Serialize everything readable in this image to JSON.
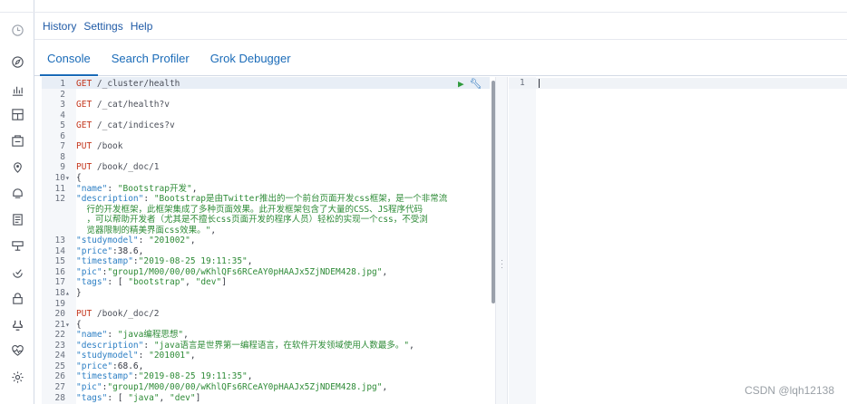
{
  "menu": [
    "History",
    "Settings",
    "Help"
  ],
  "tabs": [
    "Console",
    "Search Profiler",
    "Grok Debugger"
  ],
  "sidebar_icons": [
    "clock-icon",
    "compass-icon",
    "chart-icon",
    "dashboard-icon",
    "canvas-icon",
    "maps-icon",
    "ml-icon",
    "logs-icon",
    "metrics-icon",
    "apm-icon",
    "security-icon",
    "devtools-icon",
    "monitoring-icon",
    "settings-icon"
  ],
  "editor": {
    "lines": [
      {
        "n": "1",
        "f": "",
        "parts": [
          [
            "method",
            "GET"
          ],
          [
            "path",
            " /_cluster/health"
          ]
        ]
      },
      {
        "n": "2",
        "f": "",
        "parts": []
      },
      {
        "n": "3",
        "f": "",
        "parts": [
          [
            "method",
            "GET"
          ],
          [
            "path",
            " /_cat/health?v"
          ]
        ]
      },
      {
        "n": "4",
        "f": "",
        "parts": []
      },
      {
        "n": "5",
        "f": "",
        "parts": [
          [
            "method",
            "GET"
          ],
          [
            "path",
            " /_cat/indices?v"
          ]
        ]
      },
      {
        "n": "6",
        "f": "",
        "parts": []
      },
      {
        "n": "7",
        "f": "",
        "parts": [
          [
            "method",
            "PUT"
          ],
          [
            "path",
            " /book"
          ]
        ]
      },
      {
        "n": "8",
        "f": "",
        "parts": []
      },
      {
        "n": "9",
        "f": "",
        "parts": [
          [
            "method",
            "PUT"
          ],
          [
            "path",
            " /book/_doc/1"
          ]
        ]
      },
      {
        "n": "10",
        "f": "▾",
        "parts": [
          [
            "punc",
            "{"
          ]
        ]
      },
      {
        "n": "11",
        "f": "",
        "parts": [
          [
            "key",
            "\"name\""
          ],
          [
            "punc",
            ": "
          ],
          [
            "str",
            "\"Bootstrap开发\""
          ],
          [
            "punc",
            ","
          ]
        ]
      },
      {
        "n": "12",
        "f": "",
        "parts": [
          [
            "key",
            "\"description\""
          ],
          [
            "punc",
            ": "
          ],
          [
            "str",
            "\"Bootstrap是由Twitter推出的一个前台页面开发css框架，是一个非常流"
          ]
        ]
      },
      {
        "n": "",
        "f": "",
        "parts": [
          [
            "str",
            "  行的开发框架，此框架集成了多种页面效果。此开发框架包含了大量的CSS、JS程序代码"
          ]
        ]
      },
      {
        "n": "",
        "f": "",
        "parts": [
          [
            "str",
            "  ，可以帮助开发者（尤其是不擅长css页面开发的程序人员）轻松的实现一个css，不受浏"
          ]
        ]
      },
      {
        "n": "",
        "f": "",
        "parts": [
          [
            "str",
            "  览器限制的精美界面css效果。\""
          ],
          [
            "punc",
            ","
          ]
        ]
      },
      {
        "n": "13",
        "f": "",
        "parts": [
          [
            "key",
            "\"studymodel\""
          ],
          [
            "punc",
            ": "
          ],
          [
            "str",
            "\"201002\""
          ],
          [
            "punc",
            ","
          ]
        ]
      },
      {
        "n": "14",
        "f": "",
        "parts": [
          [
            "key",
            "\"price\""
          ],
          [
            "punc",
            ":38.6,"
          ]
        ]
      },
      {
        "n": "15",
        "f": "",
        "parts": [
          [
            "key",
            "\"timestamp\""
          ],
          [
            "punc",
            ":"
          ],
          [
            "str",
            "\"2019-08-25 19:11:35\""
          ],
          [
            "punc",
            ","
          ]
        ]
      },
      {
        "n": "16",
        "f": "",
        "parts": [
          [
            "key",
            "\"pic\""
          ],
          [
            "punc",
            ":"
          ],
          [
            "str",
            "\"group1/M00/00/00/wKhlQFs6RCeAY0pHAAJx5ZjNDEM428.jpg\""
          ],
          [
            "punc",
            ","
          ]
        ]
      },
      {
        "n": "17",
        "f": "",
        "parts": [
          [
            "key",
            "\"tags\""
          ],
          [
            "punc",
            ": [ "
          ],
          [
            "str",
            "\"bootstrap\""
          ],
          [
            "punc",
            ", "
          ],
          [
            "str",
            "\"dev\""
          ],
          [
            "punc",
            "]"
          ]
        ]
      },
      {
        "n": "18",
        "f": "▴",
        "parts": [
          [
            "punc",
            "}"
          ]
        ]
      },
      {
        "n": "19",
        "f": "",
        "parts": []
      },
      {
        "n": "20",
        "f": "",
        "parts": [
          [
            "method",
            "PUT"
          ],
          [
            "path",
            " /book/_doc/2"
          ]
        ]
      },
      {
        "n": "21",
        "f": "▾",
        "parts": [
          [
            "punc",
            "{"
          ]
        ]
      },
      {
        "n": "22",
        "f": "",
        "parts": [
          [
            "key",
            "\"name\""
          ],
          [
            "punc",
            ": "
          ],
          [
            "str",
            "\"java编程思想\""
          ],
          [
            "punc",
            ","
          ]
        ]
      },
      {
        "n": "23",
        "f": "",
        "parts": [
          [
            "key",
            "\"description\""
          ],
          [
            "punc",
            ": "
          ],
          [
            "str",
            "\"java语言是世界第一编程语言，在软件开发领域使用人数最多。\""
          ],
          [
            "punc",
            ","
          ]
        ]
      },
      {
        "n": "24",
        "f": "",
        "parts": [
          [
            "key",
            "\"studymodel\""
          ],
          [
            "punc",
            ": "
          ],
          [
            "str",
            "\"201001\""
          ],
          [
            "punc",
            ","
          ]
        ]
      },
      {
        "n": "25",
        "f": "",
        "parts": [
          [
            "key",
            "\"price\""
          ],
          [
            "punc",
            ":68.6,"
          ]
        ]
      },
      {
        "n": "26",
        "f": "",
        "parts": [
          [
            "key",
            "\"timestamp\""
          ],
          [
            "punc",
            ":"
          ],
          [
            "str",
            "\"2019-08-25 19:11:35\""
          ],
          [
            "punc",
            ","
          ]
        ]
      },
      {
        "n": "27",
        "f": "",
        "parts": [
          [
            "key",
            "\"pic\""
          ],
          [
            "punc",
            ":"
          ],
          [
            "str",
            "\"group1/M00/00/00/wKhlQFs6RCeAY0pHAAJx5ZjNDEM428.jpg\""
          ],
          [
            "punc",
            ","
          ]
        ]
      },
      {
        "n": "28",
        "f": "",
        "parts": [
          [
            "key",
            "\"tags\""
          ],
          [
            "punc",
            ": [ "
          ],
          [
            "str",
            "\"java\""
          ],
          [
            "punc",
            ", "
          ],
          [
            "str",
            "\"dev\""
          ],
          [
            "punc",
            "]"
          ]
        ]
      }
    ]
  },
  "output": {
    "line_number": "1"
  },
  "watermark": "CSDN @lqh12138"
}
